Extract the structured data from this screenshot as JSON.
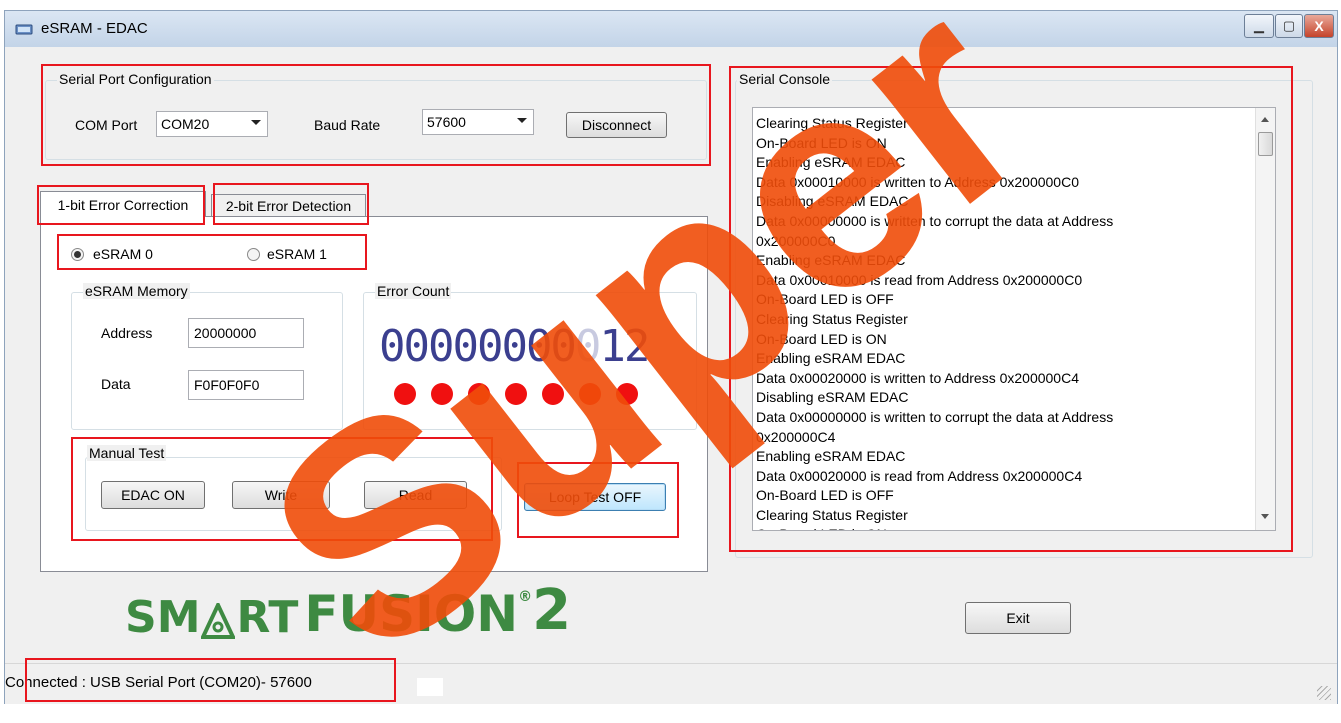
{
  "window": {
    "title": "eSRAM - EDAC",
    "minimize_glyph": "▁",
    "maximize_glyph": "▢",
    "close_glyph": "X"
  },
  "serial_config": {
    "group_label": "Serial Port Configuration",
    "com_port_label": "COM Port",
    "com_port_value": "COM20",
    "baud_rate_label": "Baud Rate",
    "baud_rate_value": "57600",
    "disconnect_label": "Disconnect"
  },
  "tabs": [
    {
      "label": "1-bit Error Correction"
    },
    {
      "label": "2-bit Error Detection"
    }
  ],
  "esram_select": [
    {
      "label": "eSRAM 0",
      "checked": true
    },
    {
      "label": "eSRAM 1",
      "checked": false
    }
  ],
  "memory": {
    "group_label": "eSRAM Memory",
    "address_label": "Address",
    "address_value": "20000000",
    "data_label": "Data",
    "data_value": "F0F0F0F0"
  },
  "error_count": {
    "group_label": "Error Count",
    "leading": "00000000",
    "dim_digit": "0",
    "value_digits": "12",
    "led_count": 7,
    "led_color": "#f01010"
  },
  "manual_test": {
    "group_label": "Manual Test",
    "edac_label": "EDAC ON",
    "write_label": "Write",
    "read_label": "Read"
  },
  "loop_test_label": "Loop Test OFF",
  "console": {
    "group_label": "Serial Console",
    "lines": [
      "Clearing Status Register",
      "On-Board LED is ON",
      "Enabling eSRAM EDAC",
      "Data 0x00010000 is written to Address 0x200000C0",
      "Disabling eSRAM EDAC",
      "Data 0x00000000 is written to corrupt the data at Address",
      "0x200000C0",
      "Enabling eSRAM EDAC",
      "Data 0x00010000 is read from Address 0x200000C0",
      "On-Board LED is OFF",
      "Clearing Status Register",
      "On-Board LED is ON",
      "Enabling eSRAM EDAC",
      "Data 0x00020000 is written to Address 0x200000C4",
      "Disabling eSRAM EDAC",
      "Data 0x00000000 is written to corrupt the data at Address",
      "0x200000C4",
      "Enabling eSRAM EDAC",
      "Data 0x00020000 is read from Address 0x200000C4",
      "On-Board LED is OFF",
      "Clearing Status Register",
      "On-Board LED is ON"
    ]
  },
  "logo": {
    "part1": "SM",
    "part2": "RT",
    "part3": "FUSION",
    "reg": "®",
    "number": "2",
    "color": "#3e8a42"
  },
  "exit_label": "Exit",
  "status_text": "Connected : USB Serial Port (COM20)- 57600",
  "watermark_text": "Super",
  "colors": {
    "highlight_red": "#e8161e",
    "digit_color": "#3b3f8f",
    "watermark": "#f04d0a"
  }
}
